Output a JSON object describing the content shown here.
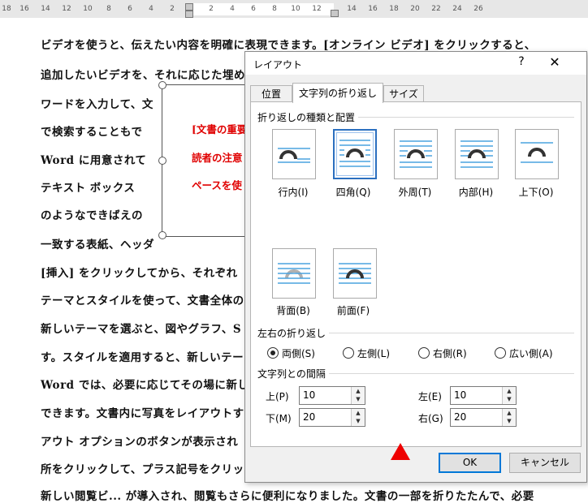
{
  "ruler": {
    "ticks": [
      "18",
      "16",
      "14",
      "12",
      "10",
      "8",
      "6",
      "4",
      "2",
      "2",
      "4",
      "6",
      "8",
      "10",
      "12",
      "14",
      "16",
      "18",
      "20",
      "22",
      "24",
      "26"
    ]
  },
  "document": {
    "lines": [
      "ビデオを使うと、伝えたい内容を明確に表現できます。[オンライン ビデオ] をクリックすると、",
      "追加したいビデオを、それに応じた埋め",
      "ワードを入力して、文",
      "で検索することもで",
      "Word に用意されて",
      "テキスト ボックス",
      "のようなできばえの",
      "一致する表紙、ヘッダ",
      "[挿入] をクリックしてから、それぞれ",
      "テーマとスタイルを使って、文書全体の",
      "新しいテーマを選ぶと、図やグラフ、S",
      "す。スタイルを適用すると、新しいテー",
      "Word では、必要に応じてその場に新し",
      "できます。文書内に写真をレイアウトす",
      "アウト オプションのボタンが表示され",
      "所をクリックして、プラス記号をクリッ",
      "新しい閲覧ビ... が導入され、閲覧もさらに便利になりました。文書の一部を折りたたんで、必要"
    ],
    "textbox_lines": [
      "[文書の重要",
      "読者の注意",
      "ペースを使"
    ]
  },
  "dialog": {
    "title": "レイアウト",
    "help": "?",
    "close": "✕",
    "tabs": [
      "位置",
      "文字列の折り返し",
      "サイズ"
    ],
    "wrap_group_label": "折り返しの種類と配置",
    "wrap_options": [
      {
        "label": "行内(I)",
        "icon": "inline-wrap-icon"
      },
      {
        "label": "四角(Q)",
        "icon": "square-wrap-icon",
        "selected": true
      },
      {
        "label": "外周(T)",
        "icon": "tight-wrap-icon"
      },
      {
        "label": "内部(H)",
        "icon": "through-wrap-icon"
      },
      {
        "label": "上下(O)",
        "icon": "top-bottom-wrap-icon"
      },
      {
        "label": "背面(B)",
        "icon": "behind-text-icon"
      },
      {
        "label": "前面(F)",
        "icon": "in-front-text-icon"
      }
    ],
    "lr_group_label": "左右の折り返し",
    "lr_options": [
      {
        "label": "両側(S)",
        "checked": true
      },
      {
        "label": "左側(L)",
        "checked": false
      },
      {
        "label": "右側(R)",
        "checked": false
      },
      {
        "label": "広い側(A)",
        "checked": false
      }
    ],
    "distance_group_label": "文字列との間隔",
    "distance": {
      "top_label": "上(P)",
      "top_value": "10",
      "bottom_label": "下(M)",
      "bottom_value": "20",
      "left_label": "左(E)",
      "left_value": "10",
      "right_label": "右(G)",
      "right_value": "20"
    },
    "ok": "OK",
    "cancel": "キャンセル"
  },
  "colors": {
    "accent": "#2b6fbf",
    "textbox_text": "#e00000",
    "triangle": "#ee0000",
    "wrap_line": "#4aa3df"
  }
}
